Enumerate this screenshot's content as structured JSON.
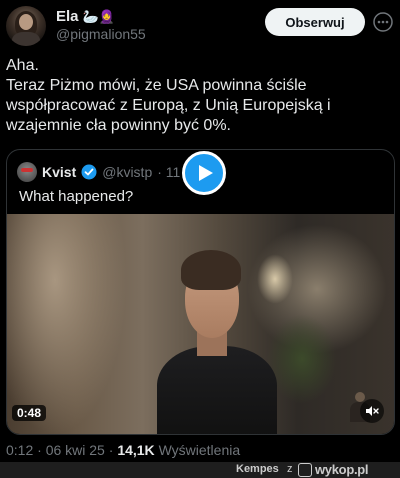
{
  "tweet": {
    "author_name": "Ela",
    "author_emoji": "🦢🧕",
    "handle": "@pigmalion55",
    "follow_label": "Obserwuj",
    "text_lines": [
      "Aha.",
      "Teraz Piżmo mówi, że USA powinna ściśle",
      "współpracować z Europą, z Unią Europejską i",
      "wzajemnie cła powinny być 0%."
    ],
    "quote": {
      "author_name": "Kvist",
      "handle": "@kvistp",
      "time": "· 11 g.",
      "text": "What happened?",
      "video_duration": "0:48"
    },
    "meta": {
      "time": "0:12",
      "date": "06 kwi 25",
      "views_count": "14,1K",
      "views_label": "Wyświetlenia"
    }
  },
  "footer": {
    "username": "Kempes",
    "connector": "z",
    "site": "wykop.pl"
  },
  "colors": {
    "accent": "#1d9bf0",
    "text": "#e7e9ea",
    "muted": "#71767b",
    "border": "#2f3336"
  }
}
